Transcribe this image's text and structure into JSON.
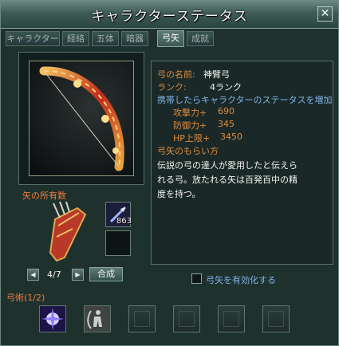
{
  "window": {
    "title": "キャラクターステータス",
    "close_glyph": "✕"
  },
  "tabs": [
    {
      "label": "キャラクター",
      "active": false
    },
    {
      "label": "経絡",
      "active": false
    },
    {
      "label": "五体",
      "active": false
    },
    {
      "label": "暗器",
      "active": false
    },
    {
      "label": "弓矢",
      "active": true
    },
    {
      "label": "成就",
      "active": false
    }
  ],
  "bow": {
    "name_label": "弓の名前:",
    "name_value": "神臂弓",
    "rank_label": "ランク:",
    "rank_value": "4ランク",
    "bonus_text": "携帯したらキャラクターのステータスを増加",
    "stats": [
      {
        "label": "攻撃力+",
        "value": "690"
      },
      {
        "label": "防御力+",
        "value": "345"
      },
      {
        "label": "HP上限+",
        "value": "3450"
      }
    ],
    "origin_heading": "弓矢のもらい方",
    "description_lines": [
      "伝説の弓の達人が愛用したと伝えら",
      "れる弓。放たれる矢は百発百中の精",
      "度を持つ。"
    ]
  },
  "arrows": {
    "heading": "矢の所有数",
    "slot_count": "863",
    "page": "4/7",
    "prev_glyph": "◀",
    "next_glyph": "▶",
    "combine_label": "合成"
  },
  "enable_arrows_label": "弓矢を有効化する",
  "archery": {
    "heading": "弓術(1/2)"
  },
  "colors": {
    "accent_orange": "#e08a3d",
    "info_blue": "#7fb3e9",
    "frame_teal": "#1f312d"
  }
}
